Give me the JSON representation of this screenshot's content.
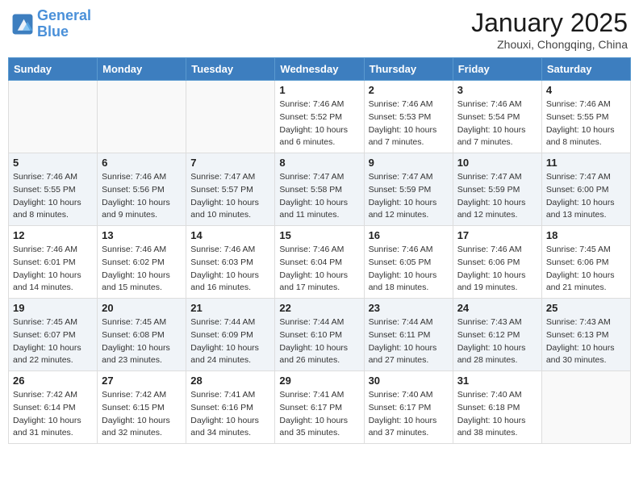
{
  "logo": {
    "line1": "General",
    "line2": "Blue"
  },
  "title": "January 2025",
  "location": "Zhouxi, Chongqing, China",
  "weekdays": [
    "Sunday",
    "Monday",
    "Tuesday",
    "Wednesday",
    "Thursday",
    "Friday",
    "Saturday"
  ],
  "weeks": [
    [
      {
        "day": "",
        "info": ""
      },
      {
        "day": "",
        "info": ""
      },
      {
        "day": "",
        "info": ""
      },
      {
        "day": "1",
        "info": "Sunrise: 7:46 AM\nSunset: 5:52 PM\nDaylight: 10 hours\nand 6 minutes."
      },
      {
        "day": "2",
        "info": "Sunrise: 7:46 AM\nSunset: 5:53 PM\nDaylight: 10 hours\nand 7 minutes."
      },
      {
        "day": "3",
        "info": "Sunrise: 7:46 AM\nSunset: 5:54 PM\nDaylight: 10 hours\nand 7 minutes."
      },
      {
        "day": "4",
        "info": "Sunrise: 7:46 AM\nSunset: 5:55 PM\nDaylight: 10 hours\nand 8 minutes."
      }
    ],
    [
      {
        "day": "5",
        "info": "Sunrise: 7:46 AM\nSunset: 5:55 PM\nDaylight: 10 hours\nand 8 minutes."
      },
      {
        "day": "6",
        "info": "Sunrise: 7:46 AM\nSunset: 5:56 PM\nDaylight: 10 hours\nand 9 minutes."
      },
      {
        "day": "7",
        "info": "Sunrise: 7:47 AM\nSunset: 5:57 PM\nDaylight: 10 hours\nand 10 minutes."
      },
      {
        "day": "8",
        "info": "Sunrise: 7:47 AM\nSunset: 5:58 PM\nDaylight: 10 hours\nand 11 minutes."
      },
      {
        "day": "9",
        "info": "Sunrise: 7:47 AM\nSunset: 5:59 PM\nDaylight: 10 hours\nand 12 minutes."
      },
      {
        "day": "10",
        "info": "Sunrise: 7:47 AM\nSunset: 5:59 PM\nDaylight: 10 hours\nand 12 minutes."
      },
      {
        "day": "11",
        "info": "Sunrise: 7:47 AM\nSunset: 6:00 PM\nDaylight: 10 hours\nand 13 minutes."
      }
    ],
    [
      {
        "day": "12",
        "info": "Sunrise: 7:46 AM\nSunset: 6:01 PM\nDaylight: 10 hours\nand 14 minutes."
      },
      {
        "day": "13",
        "info": "Sunrise: 7:46 AM\nSunset: 6:02 PM\nDaylight: 10 hours\nand 15 minutes."
      },
      {
        "day": "14",
        "info": "Sunrise: 7:46 AM\nSunset: 6:03 PM\nDaylight: 10 hours\nand 16 minutes."
      },
      {
        "day": "15",
        "info": "Sunrise: 7:46 AM\nSunset: 6:04 PM\nDaylight: 10 hours\nand 17 minutes."
      },
      {
        "day": "16",
        "info": "Sunrise: 7:46 AM\nSunset: 6:05 PM\nDaylight: 10 hours\nand 18 minutes."
      },
      {
        "day": "17",
        "info": "Sunrise: 7:46 AM\nSunset: 6:06 PM\nDaylight: 10 hours\nand 19 minutes."
      },
      {
        "day": "18",
        "info": "Sunrise: 7:45 AM\nSunset: 6:06 PM\nDaylight: 10 hours\nand 21 minutes."
      }
    ],
    [
      {
        "day": "19",
        "info": "Sunrise: 7:45 AM\nSunset: 6:07 PM\nDaylight: 10 hours\nand 22 minutes."
      },
      {
        "day": "20",
        "info": "Sunrise: 7:45 AM\nSunset: 6:08 PM\nDaylight: 10 hours\nand 23 minutes."
      },
      {
        "day": "21",
        "info": "Sunrise: 7:44 AM\nSunset: 6:09 PM\nDaylight: 10 hours\nand 24 minutes."
      },
      {
        "day": "22",
        "info": "Sunrise: 7:44 AM\nSunset: 6:10 PM\nDaylight: 10 hours\nand 26 minutes."
      },
      {
        "day": "23",
        "info": "Sunrise: 7:44 AM\nSunset: 6:11 PM\nDaylight: 10 hours\nand 27 minutes."
      },
      {
        "day": "24",
        "info": "Sunrise: 7:43 AM\nSunset: 6:12 PM\nDaylight: 10 hours\nand 28 minutes."
      },
      {
        "day": "25",
        "info": "Sunrise: 7:43 AM\nSunset: 6:13 PM\nDaylight: 10 hours\nand 30 minutes."
      }
    ],
    [
      {
        "day": "26",
        "info": "Sunrise: 7:42 AM\nSunset: 6:14 PM\nDaylight: 10 hours\nand 31 minutes."
      },
      {
        "day": "27",
        "info": "Sunrise: 7:42 AM\nSunset: 6:15 PM\nDaylight: 10 hours\nand 32 minutes."
      },
      {
        "day": "28",
        "info": "Sunrise: 7:41 AM\nSunset: 6:16 PM\nDaylight: 10 hours\nand 34 minutes."
      },
      {
        "day": "29",
        "info": "Sunrise: 7:41 AM\nSunset: 6:17 PM\nDaylight: 10 hours\nand 35 minutes."
      },
      {
        "day": "30",
        "info": "Sunrise: 7:40 AM\nSunset: 6:17 PM\nDaylight: 10 hours\nand 37 minutes."
      },
      {
        "day": "31",
        "info": "Sunrise: 7:40 AM\nSunset: 6:18 PM\nDaylight: 10 hours\nand 38 minutes."
      },
      {
        "day": "",
        "info": ""
      }
    ]
  ]
}
